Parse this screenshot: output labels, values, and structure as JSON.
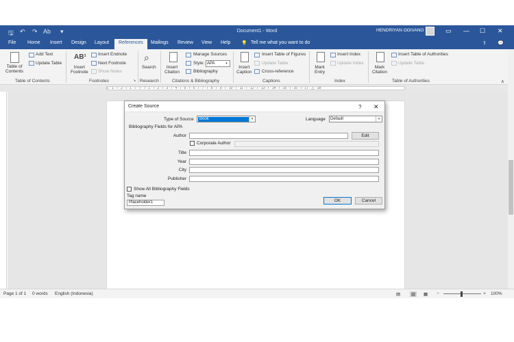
{
  "titlebar": {
    "doc_title": "Document1 - Word",
    "user": "HENDRIYAN OGIVANO"
  },
  "tabs": [
    "File",
    "Home",
    "Insert",
    "Design",
    "Layout",
    "References",
    "Mailings",
    "Review",
    "View",
    "Help"
  ],
  "active_tab": "References",
  "tell_me": "Tell me what you want to do",
  "ribbon": {
    "toc": {
      "table_of_contents": "Table of\nContents",
      "add_text": "Add Text",
      "update_table": "Update Table",
      "group": "Table of Contents"
    },
    "footnotes": {
      "insert_footnote": "Insert\nFootnote",
      "insert_endnote": "Insert Endnote",
      "next_footnote": "Next Footnote",
      "show_notes": "Show Notes",
      "group": "Footnotes"
    },
    "research": {
      "search": "Search",
      "group": "Research"
    },
    "citations": {
      "insert_citation": "Insert\nCitation",
      "manage_sources": "Manage Sources",
      "style_label": "Style:",
      "style_value": "APA",
      "bibliography": "Bibliography",
      "group": "Citations & Bibliography"
    },
    "captions": {
      "insert_caption": "Insert\nCaption",
      "insert_table_of_figures": "Insert Table of Figures",
      "update_table": "Update Table",
      "cross_reference": "Cross-reference",
      "group": "Captions"
    },
    "index": {
      "mark_entry": "Mark\nEntry",
      "insert_index": "Insert Index",
      "update_index": "Update Index",
      "group": "Index"
    },
    "authorities": {
      "mark_citation": "Mark\nCitation",
      "insert_table_of_authorities": "Insert Table of Authorities",
      "update_table": "Update Table",
      "group": "Table of Authorities"
    }
  },
  "ruler_text": "L · 1 · ı · 2 · ı · 1 · ı · ▽ · ı · 1 · ı · 2 · ı · 3 · ı · 4 · ı · 5 · ı · 6 · ı · 7 · ı · 8 · ı · 9 · ı · 10 · ı · 11 · ı · 12 · ı · 13 · ı · 14 · ı · 15 · ı · 16 · ı · 17 · △ · 18",
  "dialog": {
    "title": "Create Source",
    "help": "?",
    "close": "✕",
    "type_of_source_label": "Type of Source",
    "type_of_source_value": "Book",
    "language_label": "Language",
    "language_value": "Default",
    "fields_header": "Bibliography Fields for APA",
    "author_label": "Author",
    "edit_button": "Edit",
    "corporate_author_label": "Corporate Author",
    "title_label": "Title",
    "year_label": "Year",
    "city_label": "City",
    "publisher_label": "Publisher",
    "show_all_label": "Show All Bibliography Fields",
    "tag_name_label": "Tag name",
    "tag_name_value": "Placeholder1",
    "ok": "OK",
    "cancel": "Cancel"
  },
  "status": {
    "page": "Page 1 of 1",
    "words": "0 words",
    "language": "English (Indonesia)",
    "zoom": "100%",
    "zoom_minus": "−",
    "zoom_plus": "+"
  },
  "colors": {
    "accent": "#2b579a",
    "dialog_selection": "#0078d7"
  }
}
